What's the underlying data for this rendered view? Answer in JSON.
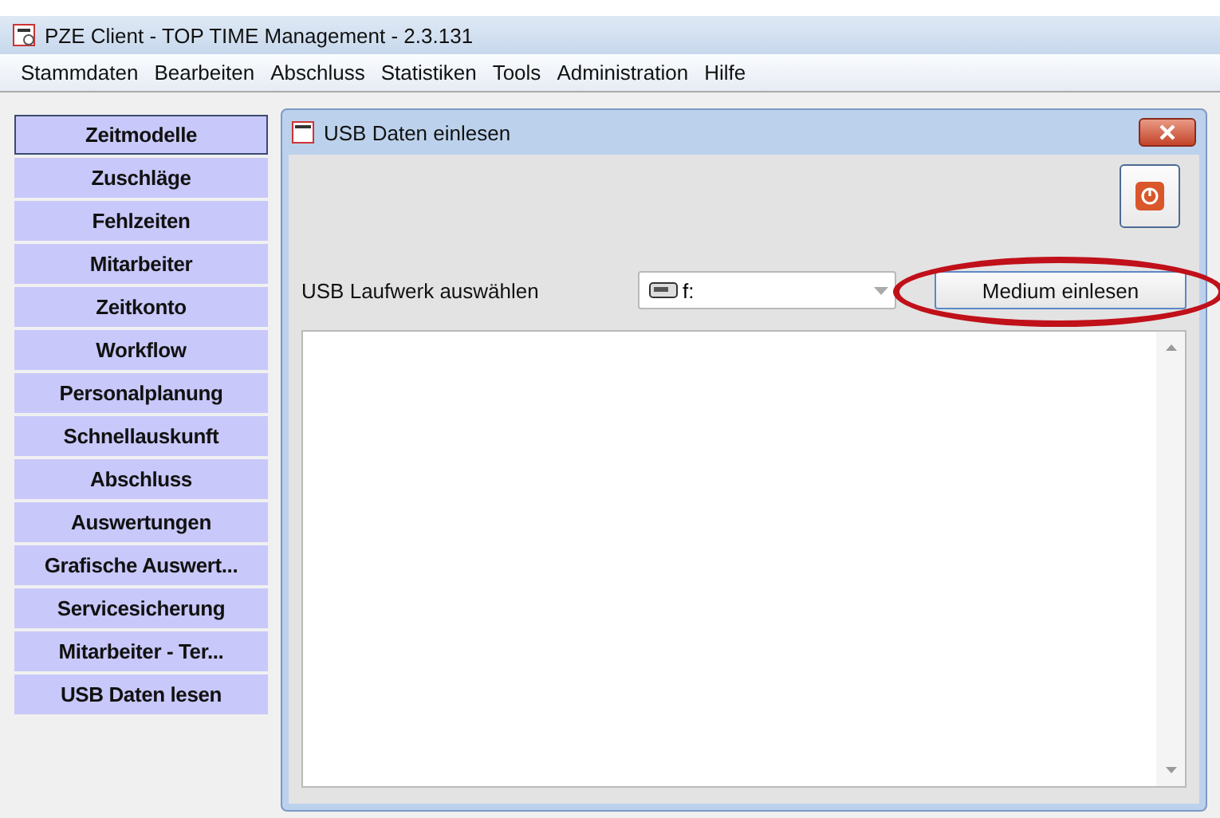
{
  "window": {
    "title": "PZE Client - TOP TIME Management - 2.3.131"
  },
  "menu": [
    "Stammdaten",
    "Bearbeiten",
    "Abschluss",
    "Statistiken",
    "Tools",
    "Administration",
    "Hilfe"
  ],
  "sidebar": {
    "items": [
      {
        "label": "Zeitmodelle",
        "selected": true
      },
      {
        "label": "Zuschläge",
        "selected": false
      },
      {
        "label": "Fehlzeiten",
        "selected": false
      },
      {
        "label": "Mitarbeiter",
        "selected": false
      },
      {
        "label": "Zeitkonto",
        "selected": false
      },
      {
        "label": "Workflow",
        "selected": false
      },
      {
        "label": "Personalplanung",
        "selected": false
      },
      {
        "label": "Schnellauskunft",
        "selected": false
      },
      {
        "label": "Abschluss",
        "selected": false
      },
      {
        "label": "Auswertungen",
        "selected": false
      },
      {
        "label": "Grafische Auswert...",
        "selected": false
      },
      {
        "label": "Servicesicherung",
        "selected": false
      },
      {
        "label": "Mitarbeiter - Ter...",
        "selected": false
      },
      {
        "label": "USB Daten lesen",
        "selected": false
      }
    ]
  },
  "dialog": {
    "title": "USB Daten einlesen",
    "drive_label": "USB Laufwerk auswählen",
    "drive_value": "f:",
    "read_button": "Medium einlesen",
    "highlighted": true
  }
}
